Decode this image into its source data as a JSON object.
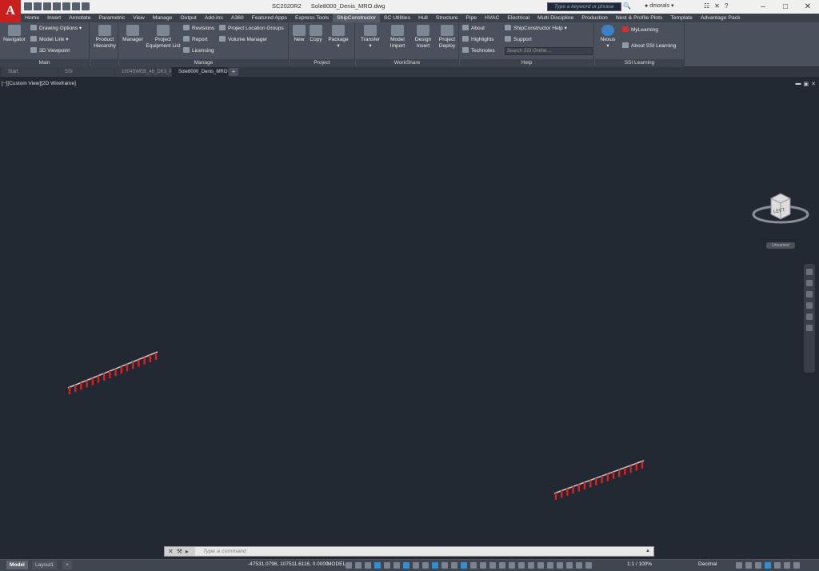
{
  "app": {
    "product": "SC2020R2",
    "filename": "Sole8000_Denis_MRO.dwg",
    "logo_letter": "A",
    "search_placeholder": "Type a keyword or phrase",
    "user": "dmorals"
  },
  "menubar": {
    "tabs": [
      "Home",
      "Insert",
      "Annotate",
      "Parametric",
      "View",
      "Manage",
      "Output",
      "Add-ins",
      "A360",
      "Featured Apps",
      "Express Tools",
      "ShipConstructor",
      "SC Utilities",
      "Hull",
      "Structure",
      "Pipe",
      "HVAC",
      "Electrical",
      "Multi Discipline",
      "Production",
      "Nest & Profile Plots",
      "Template",
      "Advantage Pack"
    ],
    "active": "ShipConstructor"
  },
  "ribbon": {
    "main": {
      "label": "Main",
      "navigator": "Navigator",
      "drawing_options": "Drawing Options",
      "model_link": "Model Link",
      "viewpoint_3d": "3D Viewpoint"
    },
    "product_hierarchy": {
      "line1": "Product",
      "line2": "Hierarchy"
    },
    "manage": {
      "label": "Manage",
      "manager": "Manager",
      "project_equipment_1": "Project",
      "project_equipment_2": "Equipment List",
      "revisions": "Revisions",
      "report": "Report",
      "licensing": "Licensing",
      "project_location_groups": "Project Location Groups",
      "volume_manager": "Volume Manager"
    },
    "project": {
      "label": "Project",
      "new": "New",
      "copy": "Copy",
      "package": "Package"
    },
    "workshare": {
      "label": "WorkShare",
      "transfer": "Transfer",
      "model_import_1": "Model",
      "model_import_2": "Import",
      "design_insert_1": "Design",
      "design_insert_2": "Insert",
      "project_deploy_1": "Project",
      "project_deploy_2": "Deploy"
    },
    "help": {
      "label": "Help",
      "about": "About",
      "highlights": "Highlights",
      "technotes": "Technotes",
      "sc_help": "ShipConstructor Help",
      "support": "Support",
      "search_online": "Search SSI Online ..."
    },
    "ssi_learning": {
      "label": "SSI Learning",
      "nexus": "Nexus",
      "mylearning": "MyLearning",
      "about_ssi": "About SSI Learning"
    }
  },
  "filetabs": [
    {
      "label": "Start",
      "active": false
    },
    {
      "label": "SSI",
      "active": false
    },
    {
      "label": "1004SWEB_46_DK3_P...",
      "active": false
    },
    {
      "label": "Sole8000_Denis_MRO*",
      "active": true
    }
  ],
  "viewport": {
    "label": "[−][Custom View][2D Wireframe]",
    "viewcube_face": "LEFT",
    "wcs": "Unnamed"
  },
  "cmdline": {
    "placeholder": "Type a command"
  },
  "statusbar": {
    "model_tab": "Model",
    "layout_tab": "Layout1",
    "coords": "-47531.0796, 107511.6116, 0.0000",
    "space": "MODEL",
    "annoscale": "1:1 / 100%",
    "units": "Decimal"
  },
  "colors": {
    "accent": "#2f8fd8",
    "geometry_red": "#e02020",
    "canvas": "#222933"
  }
}
